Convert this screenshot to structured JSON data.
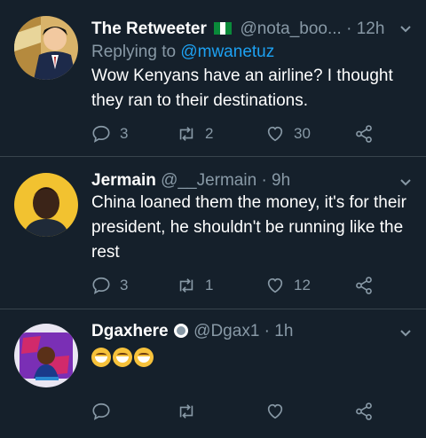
{
  "tweets": [
    {
      "name": "The Retweeter",
      "handle": "@nota_boo...",
      "time": "· 12h",
      "reply_prefix": "Replying to ",
      "reply_mention": "@mwanetuz",
      "text": "Wow Kenyans have an airline? I thought they ran to their destinations.",
      "replies": "3",
      "retweets": "2",
      "likes": "30"
    },
    {
      "name": "Jermain",
      "handle": "@__Jermain",
      "time": "· 9h",
      "text": "China loaned them the money, it's for their president, he shouldn't be running like the rest",
      "replies": "3",
      "retweets": "1",
      "likes": "12"
    },
    {
      "name": "Dgaxhere",
      "handle": "@Dgax1",
      "time": "· 1h",
      "emoji_count": "3"
    }
  ],
  "colors": {
    "background": "#15202b",
    "muted": "#8899a6",
    "link": "#1da1f2",
    "divider": "#38444d"
  },
  "icons": [
    "reply-icon",
    "retweet-icon",
    "like-icon",
    "share-icon",
    "chevron-down-icon",
    "nigeria-flag-icon",
    "verified-badge-icon"
  ]
}
